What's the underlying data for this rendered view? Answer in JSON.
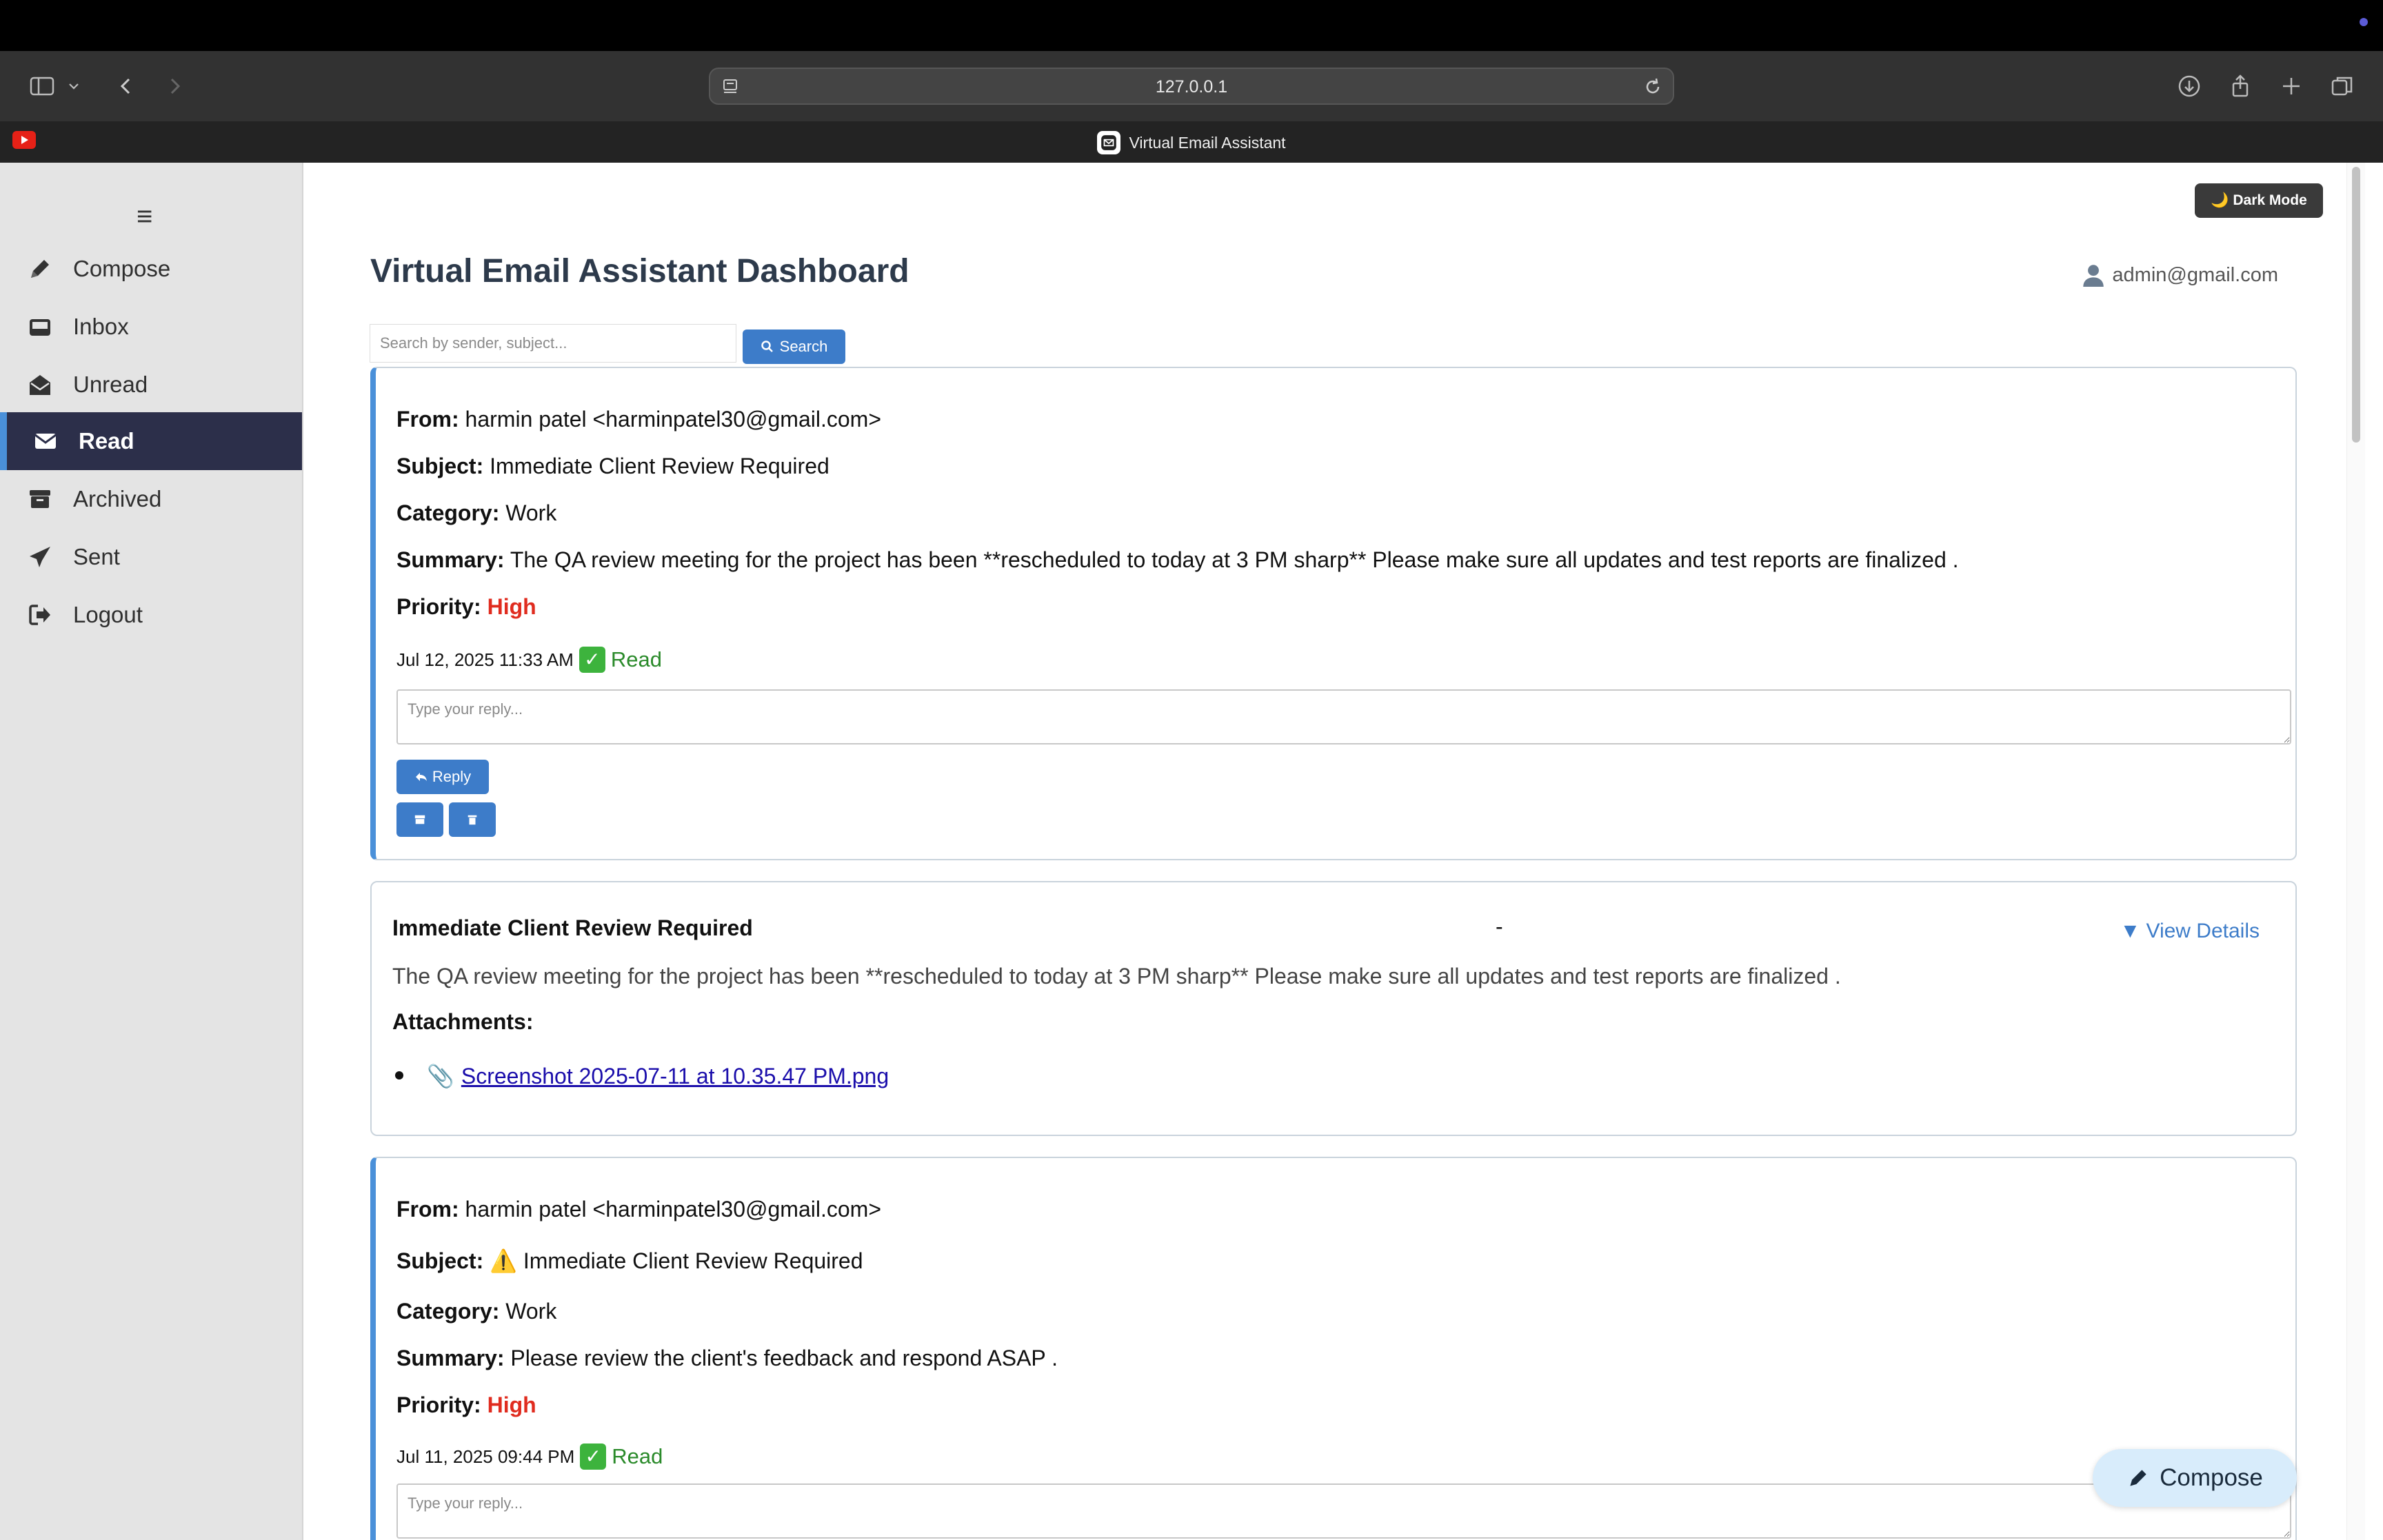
{
  "browser": {
    "url": "127.0.0.1",
    "tab_title": "Virtual Email Assistant"
  },
  "sidebar": {
    "menu_icon": "hamburger-menu-icon",
    "items": [
      {
        "label": "Compose",
        "icon": "pencil-icon"
      },
      {
        "label": "Inbox",
        "icon": "inbox-icon"
      },
      {
        "label": "Unread",
        "icon": "envelope-open-icon"
      },
      {
        "label": "Read",
        "icon": "envelope-icon",
        "active": true
      },
      {
        "label": "Archived",
        "icon": "archive-box-icon"
      },
      {
        "label": "Sent",
        "icon": "paper-plane-icon"
      },
      {
        "label": "Logout",
        "icon": "logout-icon"
      }
    ]
  },
  "header": {
    "dark_mode_label": "Dark Mode",
    "title": "Virtual Email Assistant Dashboard",
    "user_email": "admin@gmail.com"
  },
  "search": {
    "placeholder": "Search by sender, subject...",
    "button_label": "Search"
  },
  "labels": {
    "from": "From:",
    "subject": "Subject:",
    "category": "Category:",
    "summary": "Summary:",
    "priority": "Priority:",
    "reply_placeholder": "Type your reply...",
    "reply_button": "Reply",
    "attachments": "Attachments:",
    "view_details": "▼ View Details"
  },
  "emails": [
    {
      "from": "harmin patel <harminpatel30@gmail.com>",
      "subject": "Immediate Client Review Required",
      "category": "Work",
      "summary": "The QA review meeting for the project has been **rescheduled to today at 3 PM sharp** Please make sure all updates and test reports are finalized .",
      "priority": "High",
      "date": "Jul 12, 2025 11:33 AM",
      "status": "Read"
    },
    {
      "from": "harmin patel <harminpatel30@gmail.com>",
      "subject": "⚠️ Immediate Client Review Required",
      "category": "Work",
      "summary": "Please review the client's feedback and respond ASAP .",
      "priority": "High",
      "date": "Jul 11, 2025 09:44 PM",
      "status": "Read"
    }
  ],
  "detail": {
    "subject": "Immediate Client Review Required",
    "dash": "-",
    "summary": "The QA review meeting for the project has been **rescheduled to today at 3 PM sharp** Please make sure all updates and test reports are finalized .",
    "attachment": "Screenshot 2025-07-11 at 10.35.47 PM.png"
  },
  "fab": {
    "label": "Compose"
  },
  "colors": {
    "sidebar_active_bg": "#2c2f4a",
    "accent_blue": "#3d7cc9",
    "priority_high": "#e02c1f",
    "read_green": "#2a8a2a",
    "title": "#2d3a4b"
  }
}
